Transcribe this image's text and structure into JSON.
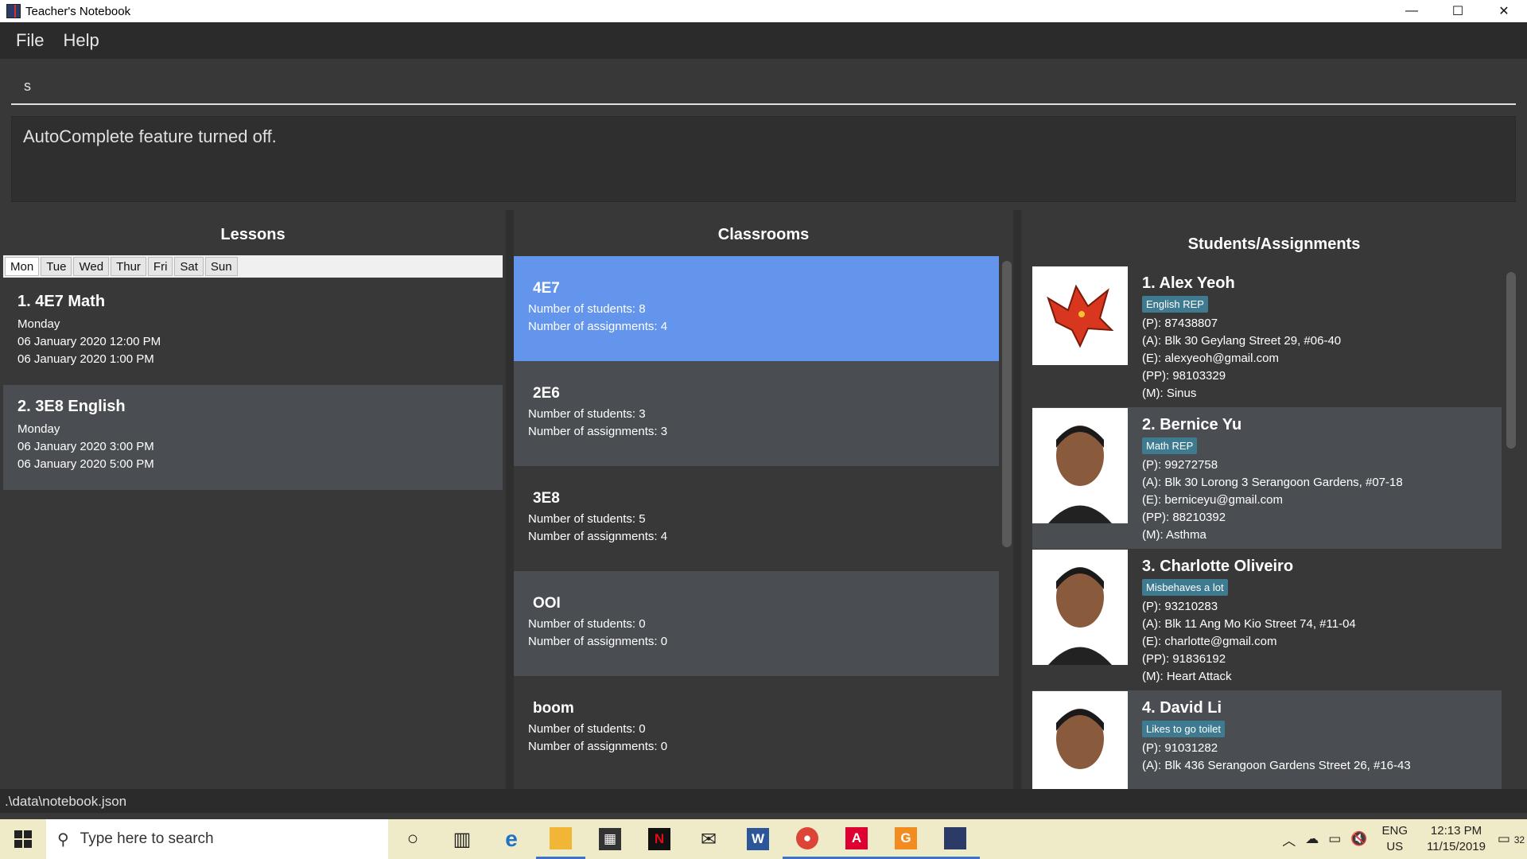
{
  "window": {
    "title": "Teacher's Notebook",
    "controls": [
      "—",
      "☐",
      "✕"
    ]
  },
  "menu": {
    "file": "File",
    "help": "Help"
  },
  "command": {
    "value": "s"
  },
  "result": {
    "text": "AutoComplete feature turned off."
  },
  "lessons": {
    "title": "Lessons",
    "days": [
      "Mon",
      "Tue",
      "Wed",
      "Thur",
      "Fri",
      "Sat",
      "Sun"
    ],
    "items": [
      {
        "title": "1.  4E7 Math",
        "day": "Monday",
        "start": "06 January 2020 12:00 PM",
        "end": "06 January 2020 1:00 PM"
      },
      {
        "title": "2.  3E8 English",
        "day": "Monday",
        "start": "06 January 2020 3:00 PM",
        "end": "06 January 2020 5:00 PM"
      }
    ]
  },
  "classrooms": {
    "title": "Classrooms",
    "items": [
      {
        "name": "4E7",
        "students": "Number of students: 8",
        "assignments": "Number of assignments: 4"
      },
      {
        "name": "2E6",
        "students": "Number of students: 3",
        "assignments": "Number of assignments: 3"
      },
      {
        "name": "3E8",
        "students": "Number of students: 5",
        "assignments": "Number of assignments: 4"
      },
      {
        "name": "OOI",
        "students": "Number of students: 0",
        "assignments": "Number of assignments: 0"
      },
      {
        "name": "boom",
        "students": "Number of students: 0",
        "assignments": "Number of assignments: 0"
      }
    ]
  },
  "students": {
    "title": "Students/Assignments",
    "items": [
      {
        "name": "1.  Alex Yeoh",
        "tag": "English REP",
        "phone": "(P): 87438807",
        "address": "(A): Blk 30 Geylang Street 29, #06-40",
        "email": "(E): alexyeoh@gmail.com",
        "parent_phone": "(PP): 98103329",
        "medical": "(M): Sinus"
      },
      {
        "name": "2.  Bernice Yu",
        "tag": "Math REP",
        "phone": "(P): 99272758",
        "address": "(A): Blk 30 Lorong 3 Serangoon Gardens, #07-18",
        "email": "(E): berniceyu@gmail.com",
        "parent_phone": "(PP): 88210392",
        "medical": "(M): Asthma"
      },
      {
        "name": "3.  Charlotte Oliveiro",
        "tag": "Misbehaves a lot",
        "phone": "(P): 93210283",
        "address": "(A): Blk 11 Ang Mo Kio Street 74, #11-04",
        "email": "(E): charlotte@gmail.com",
        "parent_phone": "(PP): 91836192",
        "medical": "(M): Heart Attack"
      },
      {
        "name": "4.  David Li",
        "tag": "Likes to go toilet",
        "phone": "(P): 91031282",
        "address": "(A): Blk 436 Serangoon Gardens Street 26, #16-43",
        "email": "",
        "parent_phone": "",
        "medical": ""
      }
    ]
  },
  "status": {
    "path": ".\\data\\notebook.json"
  },
  "taskbar": {
    "search_placeholder": "Type here to search",
    "lang1": "ENG",
    "lang2": "US",
    "time": "12:13 PM",
    "date": "11/15/2019",
    "notifications": "32"
  },
  "colors": {
    "selected": "#6495ed",
    "tag": "#3e7b91",
    "taskbar": "#efeac7"
  }
}
